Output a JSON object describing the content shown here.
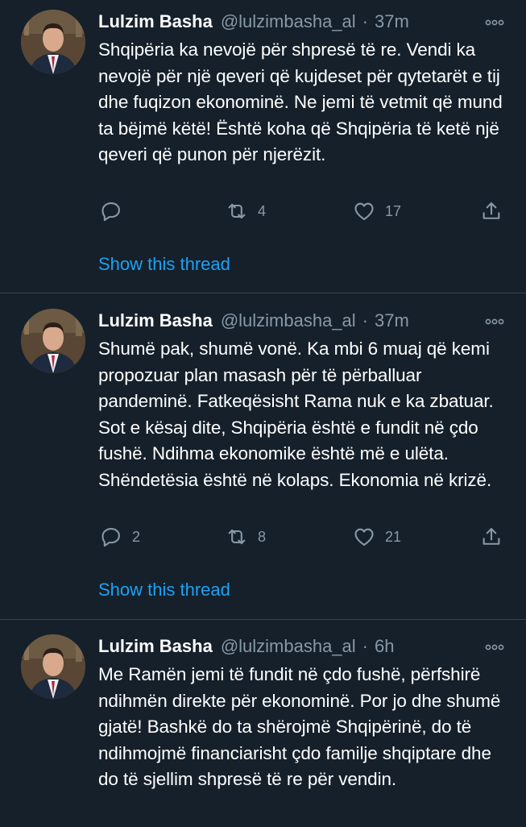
{
  "tweets": [
    {
      "name": "Lulzim Basha",
      "handle": "@lulzimbasha_al",
      "separator": "·",
      "time": "37m",
      "text": "Shqipëria ka nevojë për shpresë të re. Vendi ka nevojë për një qeveri që kujdeset për qytetarët e tij dhe fuqizon ekonominë. Ne jemi të vetmit që mund ta bëjmë këtë! Është koha që Shqipëria të ketë një qeveri që punon për njerëzit.",
      "replies": "",
      "retweets": "4",
      "likes": "17",
      "show_thread": "Show this thread"
    },
    {
      "name": "Lulzim Basha",
      "handle": "@lulzimbasha_al",
      "separator": "·",
      "time": "37m",
      "text": "Shumë pak, shumë vonë. Ka mbi 6 muaj që kemi propozuar plan masash për të përballuar pandeminë. Fatkeqësisht Rama nuk e ka zbatuar. Sot e kësaj dite, Shqipëria është e fundit në çdo fushë. Ndihma ekonomike është më e ulëta. Shëndetësia është në kolaps. Ekonomia në krizë.",
      "replies": "2",
      "retweets": "8",
      "likes": "21",
      "show_thread": "Show this thread"
    },
    {
      "name": "Lulzim Basha",
      "handle": "@lulzimbasha_al",
      "separator": "·",
      "time": "6h",
      "text": "Me Ramën jemi të fundit në çdo fushë, përfshirë ndihmën direkte për ekonominë. Por jo dhe shumë gjatë! Bashkë do ta shërojmë Shqipërinë, do të ndihmojmë financiarisht çdo familje shqiptare dhe do të sjellim shpresë të re për vendin."
    }
  ],
  "colors": {
    "background": "#15202b",
    "divider": "#38444d",
    "secondary_text": "#8899a6",
    "link": "#1da1f2"
  },
  "icons": [
    "more-icon",
    "reply-icon",
    "retweet-icon",
    "like-icon",
    "share-icon"
  ]
}
